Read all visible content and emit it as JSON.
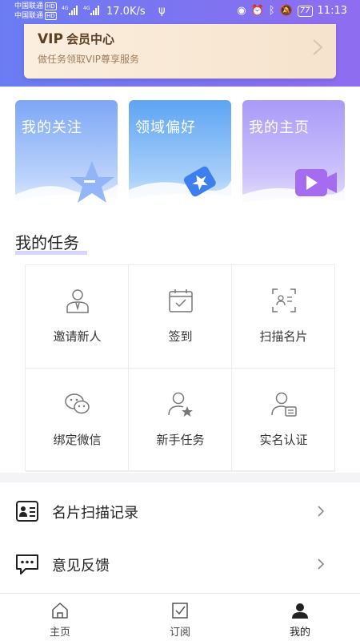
{
  "status_bar": {
    "carrier_1": "中国联通",
    "carrier_2": "中国联通",
    "hd": "HD",
    "net_1": "4G",
    "net_2": "4G",
    "speed": "17.0K/s",
    "battery": "77",
    "time": "11:13"
  },
  "vip_banner": {
    "title_prefix": "VIP",
    "title": "会员中心",
    "subtitle": "做任务领取VIP尊享服务"
  },
  "feature_cards": [
    {
      "label": "我的关注",
      "icon": "star-icon"
    },
    {
      "label": "领域偏好",
      "icon": "tag-star-icon"
    },
    {
      "label": "我的主页",
      "icon": "video-icon"
    }
  ],
  "tasks": {
    "title": "我的任务",
    "items": [
      {
        "label": "邀请新人",
        "icon": "person-icon"
      },
      {
        "label": "签到",
        "icon": "calendar-check-icon"
      },
      {
        "label": "扫描名片",
        "icon": "scan-card-icon"
      },
      {
        "label": "绑定微信",
        "icon": "wechat-icon"
      },
      {
        "label": "新手任务",
        "icon": "user-star-icon"
      },
      {
        "label": "实名认证",
        "icon": "id-verify-icon"
      }
    ]
  },
  "menu": [
    {
      "label": "名片扫描记录",
      "icon": "card-record-icon"
    },
    {
      "label": "意见反馈",
      "icon": "feedback-icon"
    }
  ],
  "tab_bar": [
    {
      "label": "主页",
      "icon": "home-icon",
      "active": false
    },
    {
      "label": "订阅",
      "icon": "subscribe-icon",
      "active": false
    },
    {
      "label": "我的",
      "icon": "user-icon",
      "active": true
    }
  ],
  "colors": {
    "header_start": "#6b7cf3",
    "header_end": "#8f6df0",
    "vip_text": "#5a3f22",
    "accent_underline": "#d7d5fb"
  }
}
